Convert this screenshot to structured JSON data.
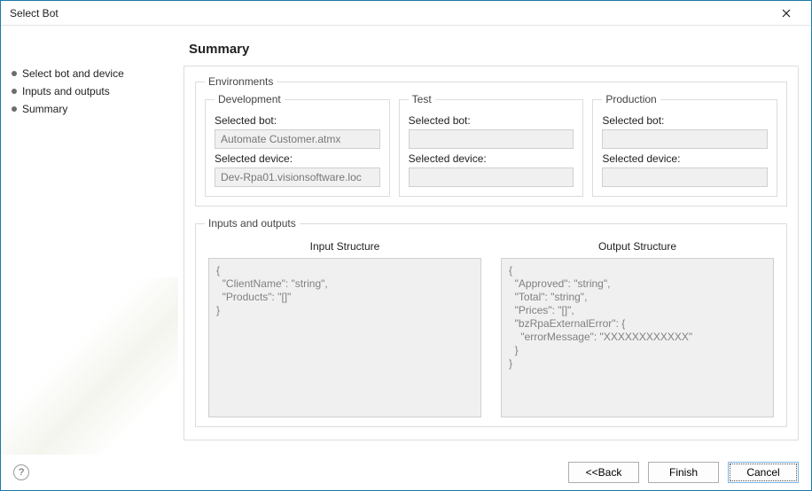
{
  "window": {
    "title": "Select Bot"
  },
  "sidebar": {
    "steps": [
      {
        "label": "Select bot and device"
      },
      {
        "label": "Inputs and outputs"
      },
      {
        "label": "Summary"
      }
    ]
  },
  "heading": "Summary",
  "environments": {
    "legend": "Environments",
    "columns": [
      {
        "legend": "Development",
        "bot_label": "Selected bot:",
        "bot_value": "Automate Customer.atmx",
        "device_label": "Selected device:",
        "device_value": "Dev-Rpa01.visionsoftware.loc"
      },
      {
        "legend": "Test",
        "bot_label": "Selected bot:",
        "bot_value": "",
        "device_label": "Selected device:",
        "device_value": ""
      },
      {
        "legend": "Production",
        "bot_label": "Selected bot:",
        "bot_value": "",
        "device_label": "Selected device:",
        "device_value": ""
      }
    ]
  },
  "io": {
    "legend": "Inputs and outputs",
    "input_title": "Input Structure",
    "output_title": "Output Structure",
    "input_text": "{\n  \"ClientName\": \"string\",\n  \"Products\": \"[]\"\n}",
    "output_text": "{\n  \"Approved\": \"string\",\n  \"Total\": \"string\",\n  \"Prices\": \"[]\",\n  \"bzRpaExternalError\": {\n    \"errorMessage\": \"XXXXXXXXXXXX\"\n  }\n}"
  },
  "footer": {
    "back": "<<Back",
    "finish": "Finish",
    "cancel": "Cancel"
  }
}
